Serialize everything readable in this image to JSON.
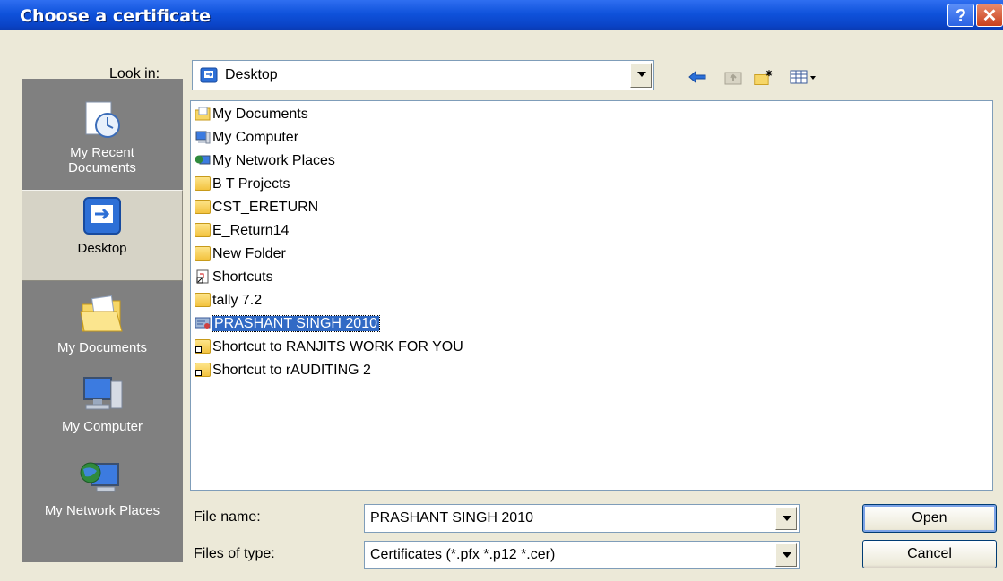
{
  "window": {
    "title": "Choose a certificate",
    "help_glyph": "?",
    "close_glyph": "✕"
  },
  "lookin": {
    "label": "Look in:",
    "value": "Desktop"
  },
  "toolbar": {
    "back": "back-arrow-icon",
    "up": "up-one-level-icon",
    "new_folder": "new-folder-icon",
    "views": "views-menu-icon"
  },
  "places": [
    {
      "label": "My Recent Documents",
      "icon": "recent-documents-icon"
    },
    {
      "label": "Desktop",
      "icon": "desktop-icon"
    },
    {
      "label": "My Documents",
      "icon": "my-documents-icon"
    },
    {
      "label": "My Computer",
      "icon": "my-computer-icon"
    },
    {
      "label": "My Network Places",
      "icon": "network-places-icon"
    }
  ],
  "files": [
    {
      "name": "My Documents",
      "icon": "my-documents-icon"
    },
    {
      "name": "My Computer",
      "icon": "my-computer-icon"
    },
    {
      "name": "My Network Places",
      "icon": "network-places-icon"
    },
    {
      "name": "B T Projects",
      "icon": "folder-icon"
    },
    {
      "name": "CST_ERETURN",
      "icon": "folder-icon"
    },
    {
      "name": "E_Return14",
      "icon": "folder-icon"
    },
    {
      "name": "New Folder",
      "icon": "folder-icon"
    },
    {
      "name": "Shortcuts",
      "icon": "shortcut-file-icon"
    },
    {
      "name": "tally 7.2",
      "icon": "folder-icon"
    },
    {
      "name": "PRASHANT SINGH  2010",
      "icon": "certificate-icon",
      "selected": true
    },
    {
      "name": "Shortcut to RANJITS WORK FOR YOU",
      "icon": "folder-shortcut-icon"
    },
    {
      "name": "Shortcut to rAUDITING 2",
      "icon": "folder-shortcut-icon"
    }
  ],
  "filename": {
    "label": "File name:",
    "value": "PRASHANT SINGH  2010"
  },
  "filetype": {
    "label": "Files of type:",
    "value": "Certificates (*.pfx *.p12 *.cer)"
  },
  "buttons": {
    "open": "Open",
    "cancel": "Cancel"
  },
  "colors": {
    "titlebar": "#0a43c6",
    "dialog_bg": "#ece9d8",
    "selection": "#316ac5",
    "places_bg": "#808080"
  }
}
